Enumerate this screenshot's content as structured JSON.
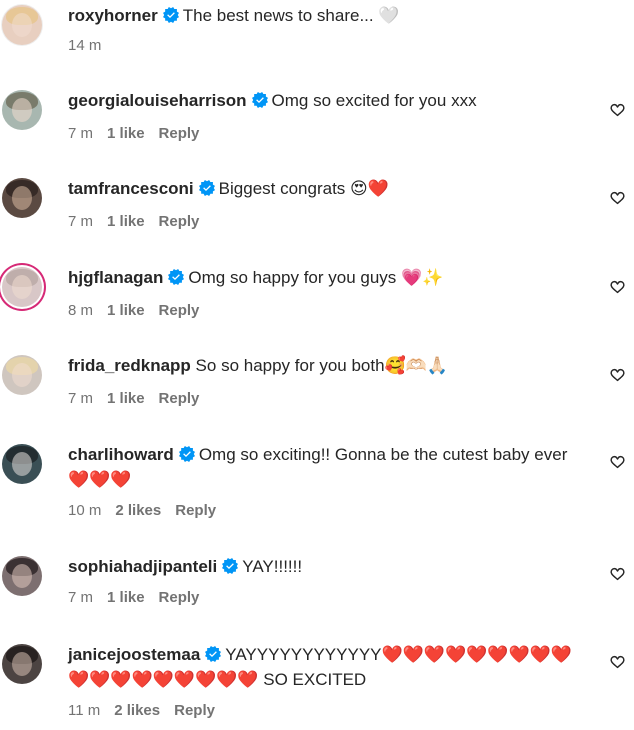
{
  "caption": {
    "username": "roxyhorner",
    "text": "The best news to share...",
    "emoji": "🤍",
    "time": "14 m"
  },
  "comments": [
    {
      "username": "georgialouiseharrison",
      "verified": true,
      "text": "Omg so excited for you xxx",
      "time": "7 m",
      "likes": "1 like",
      "reply": "Reply"
    },
    {
      "username": "tamfrancesconi",
      "verified": true,
      "text": "Biggest congrats 😍❤️",
      "time": "7 m",
      "likes": "1 like",
      "reply": "Reply"
    },
    {
      "username": "hjgflanagan",
      "verified": true,
      "text": "Omg so happy for you guys 💗✨",
      "time": "8 m",
      "likes": "1 like",
      "reply": "Reply"
    },
    {
      "username": "frida_redknapp",
      "verified": false,
      "text": "So so happy for you both🥰🫶🏻🙏🏻",
      "time": "7 m",
      "likes": "1 like",
      "reply": "Reply"
    },
    {
      "username": "charlihoward",
      "verified": true,
      "text": "Omg so exciting!! Gonna be the cutest baby ever ❤️❤️❤️",
      "time": "10 m",
      "likes": "2 likes",
      "reply": "Reply"
    },
    {
      "username": "sophiahadjipanteli",
      "verified": true,
      "text": "YAY!!!!!!",
      "time": "7 m",
      "likes": "1 like",
      "reply": "Reply"
    },
    {
      "username": "janicejoostemaa",
      "verified": true,
      "text": "YAYYYYYYYYYYYY❤️❤️❤️❤️❤️❤️❤️❤️❤️❤️❤️❤️❤️❤️❤️❤️❤️❤️ SO EXCITED",
      "time": "11 m",
      "likes": "2 likes",
      "reply": "Reply"
    }
  ],
  "colors": {
    "text": "#262626",
    "secondary": "#737373",
    "verified": "#0095f6",
    "story_ring": "#d62976"
  },
  "icons": {
    "verified": "verified-badge-icon",
    "like": "heart-outline-icon"
  }
}
